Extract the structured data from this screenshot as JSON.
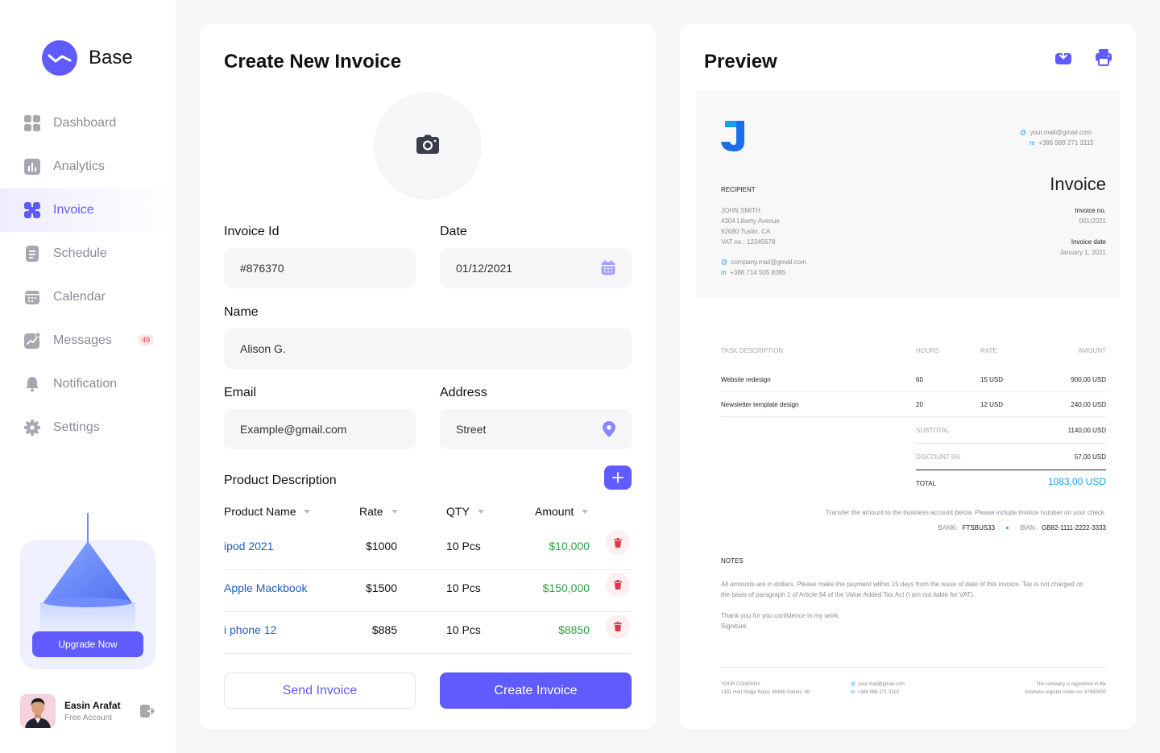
{
  "sidebar": {
    "brand": "Base",
    "items": [
      {
        "label": "Dashboard",
        "icon": "dashboard-icon"
      },
      {
        "label": "Analytics",
        "icon": "analytics-icon"
      },
      {
        "label": "Invoice",
        "icon": "invoice-icon",
        "active": true
      },
      {
        "label": "Schedule",
        "icon": "schedule-icon"
      },
      {
        "label": "Calendar",
        "icon": "calendar-icon"
      },
      {
        "label": "Messages",
        "icon": "messages-icon",
        "badge": "49"
      },
      {
        "label": "Notification",
        "icon": "bell-icon"
      },
      {
        "label": "Settings",
        "icon": "gear-icon"
      }
    ],
    "upgrade_label": "Upgrade Now",
    "user": {
      "name": "Easin Arafat",
      "plan": "Free Account"
    }
  },
  "form": {
    "title": "Create New Invoice",
    "invoice_id_label": "Invoice Id",
    "invoice_id_value": "#876370",
    "date_label": "Date",
    "date_value": "01/12/2021",
    "name_label": "Name",
    "name_value": "Alison G.",
    "email_label": "Email",
    "email_placeholder": "Example@gmail.com",
    "address_label": "Address",
    "address_placeholder": "Street",
    "product_section": "Product Description",
    "columns": [
      "Product Name",
      "Rate",
      "QTY",
      "Amount"
    ],
    "products": [
      {
        "name": "ipod 2021",
        "rate": "$1000",
        "qty": "10 Pcs",
        "amount": "$10,000"
      },
      {
        "name": "Apple Mackbook",
        "rate": "$1500",
        "qty": "10 Pcs",
        "amount": "$150,000"
      },
      {
        "name": "i phone 12",
        "rate": "$885",
        "qty": "10 Pcs",
        "amount": "$8850"
      }
    ],
    "send_label": "Send Invoice",
    "create_label": "Create Invoice"
  },
  "preview": {
    "title": "Preview",
    "doc": {
      "logo_letter": "J",
      "contact_email_prefix": "@",
      "contact_email": "your.mail@gmail.com",
      "contact_phone_prefix": "m",
      "contact_phone": "+386 989 271 3115",
      "recipient_label": "RECIPIENT",
      "recipient_name": "JOHN SMITH",
      "recipient_street": "4304 Liberty Avenue",
      "recipient_city": "92680 Tustin, CA",
      "recipient_vat": "VAT no.: 12345678",
      "recipient_email": "company.mail@gmail.com",
      "recipient_phone": "+386 714 505 8385",
      "invoice_word": "Invoice",
      "invoice_no_label": "Invoice no.",
      "invoice_no": "001/2021",
      "invoice_date_label": "Invoice date",
      "invoice_date": "January 1, 2021",
      "table_headers": [
        "TASK DESCRIPTION",
        "HOURS",
        "RATE",
        "AMOUNT"
      ],
      "tasks": [
        {
          "desc": "Website redesign",
          "hours": "60",
          "rate": "15 USD",
          "amount": "900,00 USD"
        },
        {
          "desc": "Newsletter template design",
          "hours": "20",
          "rate": "12 USD",
          "amount": "240,00 USD"
        }
      ],
      "subtotal_label": "SUBTOTAL",
      "subtotal": "1140,00 USD",
      "discount_label": "DISCOUNT 5%",
      "discount": "57,00 USD",
      "total_label": "TOTAL",
      "total": "1083,00 USD",
      "transfer_note": "Transfer the amount to the business account below. Please include invoice number on your check.",
      "bank_label": "BANK:",
      "bank": "FTSBUS33",
      "iban_label": "IBAN:",
      "iban": "GB82-1111-2222-3333",
      "notes_label": "NOTES",
      "notes_1": "All amounts are in dollars. Please make the payment within 15 days from the issue of date of this invoice. Tax is not charged on",
      "notes_2": "the basis of paragraph 1 of Article 94 of the Value Added Tax Act (I am not liable for VAT).",
      "thanks": "Thank you for you confidence in my work.",
      "signature": "Signiture",
      "footer_company": "YOUR COMPANY",
      "footer_address": "1331 Hart Ridge Road, 48436 Gaines, MI",
      "footer_email": "your.mail@gmail.com",
      "footer_phone": "+386 989 271 3115",
      "footer_reg_1": "The company is registered in the",
      "footer_reg_2": "business register under no. 87650000"
    }
  },
  "colors": {
    "accent": "#605bff",
    "positive": "#2ea043",
    "link": "#1e5fb8",
    "danger": "#e0364b",
    "doc_accent": "#1aa0e8"
  }
}
